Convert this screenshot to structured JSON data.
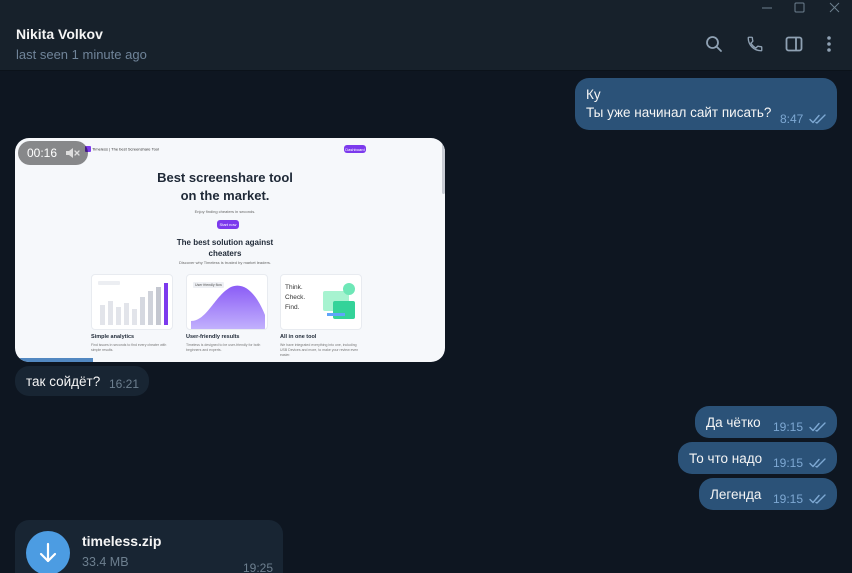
{
  "window": {
    "controls": [
      "minimize-icon",
      "maximize-icon",
      "close-icon"
    ]
  },
  "header": {
    "name": "Nikita Volkov",
    "status": "last seen 1 minute ago",
    "icons": [
      "search-icon",
      "phone-icon",
      "sidebar-toggle-icon",
      "more-vertical-icon"
    ]
  },
  "messages": {
    "m1": {
      "line1": "Ку",
      "line2": "Ты уже начинал сайт писать?",
      "time": "8:47"
    },
    "video": {
      "duration": "00:16",
      "site": {
        "header": "Timeless | The best Screenshare Tool",
        "header_btn": "Dashboard",
        "hero_line1": "Best screenshare tool",
        "hero_line2": "on the market.",
        "hero_sub": "Enjoy finding cheaters in seconds.",
        "cta": "Start now",
        "section_line1": "The best solution against",
        "section_line2": "cheaters",
        "section_sub": "Discover why Timeless is trusted by market leaders.",
        "card1_title": "Simple analytics",
        "card1_text": "Find issues in seconds to find every cheater with simple results.",
        "card2_title": "User-friendly results",
        "card2_text": "Timeless is designed to be user-friendly for both beginners and experts.",
        "card2_tag": "User friendly flow",
        "card3_title": "All in one tool",
        "card3_text": "We have integrated everything into one, including USB Devices and more, to make your review even easier.",
        "card3_words": [
          "Think.",
          "Check.",
          "Find."
        ]
      }
    },
    "m2": {
      "text": "так сойдёт?",
      "time": "16:21"
    },
    "m3": {
      "text": "Да чётко",
      "time": "19:15"
    },
    "m4": {
      "text": "То что надо",
      "time": "19:15"
    },
    "m5": {
      "text": "Легенда",
      "time": "19:15"
    },
    "file": {
      "name": "timeless.zip",
      "size": "33.4 MB",
      "time": "19:25"
    }
  },
  "colors": {
    "background": "#0e1621",
    "header": "#17212b",
    "outgoing": "#2b5278",
    "incoming": "#182533",
    "accent": "#4c9ce2"
  }
}
